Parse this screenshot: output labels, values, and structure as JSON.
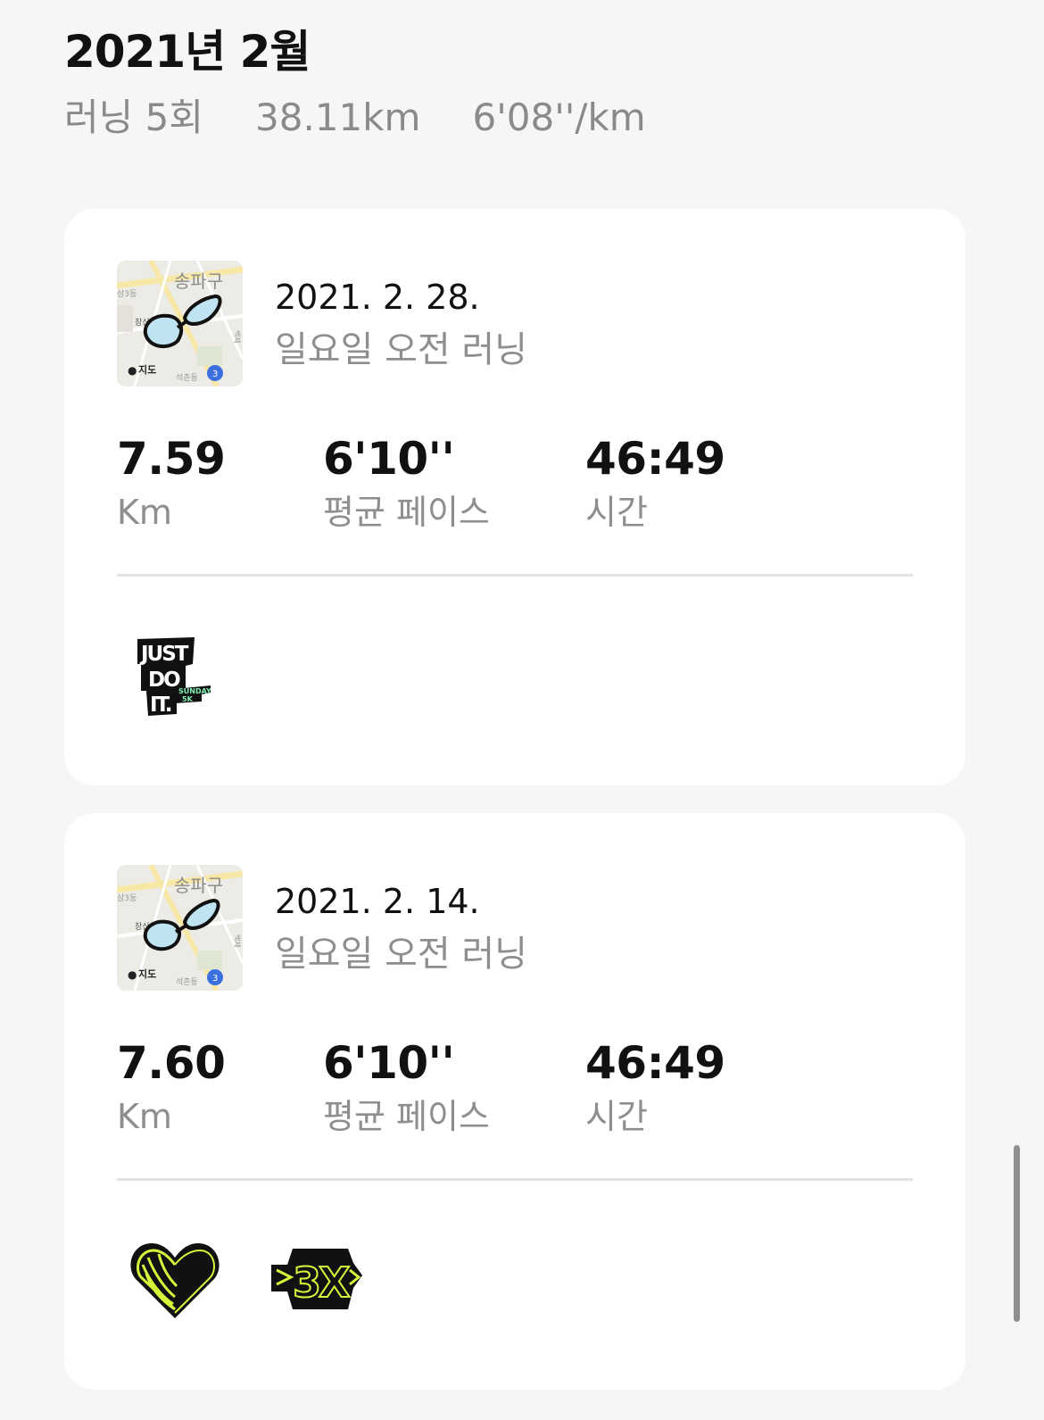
{
  "month": {
    "title": "2021년 2월",
    "runs": "러닝 5회",
    "distance": "38.11km",
    "pace": "6'08''/km"
  },
  "activities": [
    {
      "date": "2021. 2. 28.",
      "name": "일요일 오전 러닝",
      "distance_value": "7.59",
      "distance_label": "Km",
      "pace_value": "6'10''",
      "pace_label": "평균 페이스",
      "time_value": "46:49",
      "time_label": "시간",
      "map": {
        "district": "송파구",
        "label_a": "장신로",
        "label_b": "석촌동",
        "label_c": "백제",
        "label_d": "삼3동",
        "brand": "지도",
        "route": "3"
      },
      "badges": [
        {
          "icon": "just-do-it-sunday-5k",
          "text_main": [
            "JUST",
            "DO",
            "IT."
          ],
          "text_sub": [
            "SUNDAY",
            "5K"
          ]
        }
      ]
    },
    {
      "date": "2021. 2. 14.",
      "name": "일요일 오전 러닝",
      "distance_value": "7.60",
      "distance_label": "Km",
      "pace_value": "6'10''",
      "pace_label": "평균 페이스",
      "time_value": "46:49",
      "time_label": "시간",
      "map": {
        "district": "송파구",
        "label_a": "장신로",
        "label_b": "석촌동",
        "label_c": "백제",
        "label_d": "삼3동",
        "brand": "지도",
        "route": "3"
      },
      "badges": [
        {
          "icon": "heart-badge"
        },
        {
          "icon": "3x-badge",
          "text": "3X"
        }
      ]
    }
  ],
  "colors": {
    "background": "#f6f6f6",
    "card": "#ffffff",
    "muted": "#8e8e8e",
    "badge_neon": "#d6f53a",
    "badge_dark": "#111111",
    "route_fill": "#bfe3f0"
  }
}
